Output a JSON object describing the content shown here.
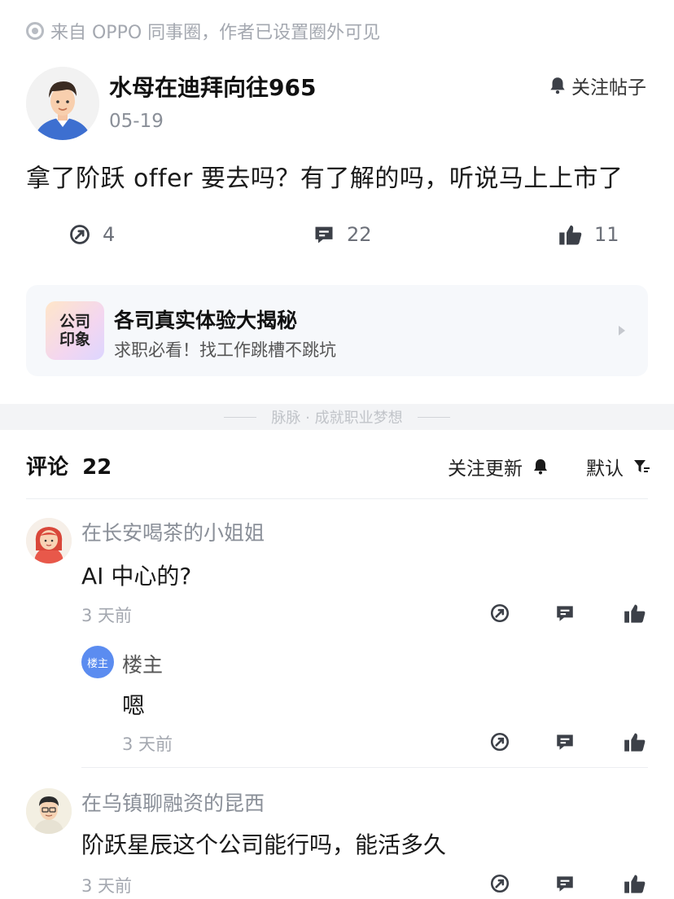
{
  "source_notice": "来自 OPPO 同事圈，作者已设置圈外可见",
  "post": {
    "author": "水母在迪拜向往965",
    "date": "05-19",
    "follow_label": "关注帖子",
    "text": "拿了阶跃 offer 要去吗？有了解的吗，听说马上上市了",
    "stats": {
      "shares": "4",
      "comments": "22",
      "likes": "11"
    }
  },
  "promo": {
    "logo_line1": "公司",
    "logo_line2": "印象",
    "title": "各司真实体验大揭秘",
    "subtitle": "求职必看！找工作跳槽不跳坑"
  },
  "divider_text": "脉脉 · 成就职业梦想",
  "comments_header": {
    "label": "评论",
    "count": "22",
    "follow_updates": "关注更新",
    "sort": "默认"
  },
  "comments": [
    {
      "name": "在长安喝茶的小姐姐",
      "text": "AI 中心的?",
      "time": "3 天前",
      "reply": {
        "badge": "楼主",
        "name": "楼主",
        "text": "嗯",
        "time": "3 天前"
      }
    },
    {
      "name": "在乌镇聊融资的昆西",
      "text": "阶跃星辰这个公司能行吗，能活多久",
      "time": "3 天前"
    }
  ],
  "colors": {
    "accent": "#5b8cf0",
    "icon": "#3c4048",
    "muted": "#a4a8b0"
  },
  "icons": [
    "share-icon",
    "comment-icon",
    "thumbs-up-icon",
    "bell-icon",
    "filter-icon"
  ]
}
